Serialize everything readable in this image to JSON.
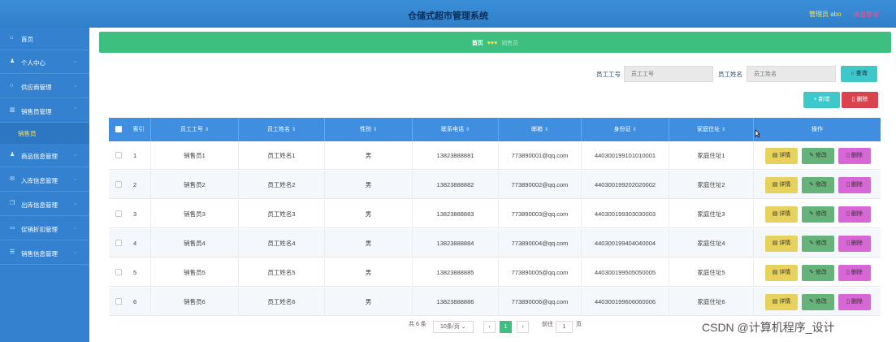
{
  "header": {
    "title": "仓储式超市管理系统",
    "admin": "管理员 abo",
    "logout": "退出登录"
  },
  "sidebar": {
    "items": [
      {
        "label": "首页",
        "icon": "home-icon"
      },
      {
        "label": "个人中心",
        "icon": "user-icon"
      },
      {
        "label": "供应商管理",
        "icon": "circle-icon"
      },
      {
        "label": "销售员管理",
        "icon": "chart-icon"
      },
      {
        "label": "商品信息管理",
        "icon": "user-icon"
      },
      {
        "label": "入库信息管理",
        "icon": "mail-icon"
      },
      {
        "label": "出库信息管理",
        "icon": "copy-icon"
      },
      {
        "label": "促销折扣管理",
        "icon": "doc-icon"
      },
      {
        "label": "销售信息管理",
        "icon": "list-icon"
      }
    ],
    "active_sub": "销售员"
  },
  "breadcrumb": {
    "home": "首页",
    "hearts": "♥♥♥",
    "current": "销售员"
  },
  "search": {
    "label_id": "员工工号",
    "placeholder_id": "员工工号",
    "label_name": "员工姓名",
    "placeholder_name": "员工姓名",
    "button": "查询"
  },
  "actions": {
    "add": "新增",
    "delete": "删除"
  },
  "table": {
    "headers": [
      "索引",
      "员工工号",
      "员工姓名",
      "性别",
      "联系电话",
      "邮箱",
      "身份证",
      "家庭住址",
      "操作"
    ],
    "rows": [
      {
        "idx": "1",
        "id": "销售员1",
        "name": "员工姓名1",
        "gender": "男",
        "phone": "13823888881",
        "email": "773890001@qq.com",
        "idcard": "440300199101010001",
        "addr": "家庭住址1"
      },
      {
        "idx": "2",
        "id": "销售员2",
        "name": "员工姓名2",
        "gender": "男",
        "phone": "13823888882",
        "email": "773890002@qq.com",
        "idcard": "440300199202020002",
        "addr": "家庭住址2"
      },
      {
        "idx": "3",
        "id": "销售员3",
        "name": "员工姓名3",
        "gender": "男",
        "phone": "13823888883",
        "email": "773890003@qq.com",
        "idcard": "440300199303030003",
        "addr": "家庭住址3"
      },
      {
        "idx": "4",
        "id": "销售员4",
        "name": "员工姓名4",
        "gender": "男",
        "phone": "13823888884",
        "email": "773890004@qq.com",
        "idcard": "440300199404040004",
        "addr": "家庭住址4"
      },
      {
        "idx": "5",
        "id": "销售员5",
        "name": "员工姓名5",
        "gender": "男",
        "phone": "13823888885",
        "email": "773890005@qq.com",
        "idcard": "440300199505050005",
        "addr": "家庭住址5"
      },
      {
        "idx": "6",
        "id": "销售员6",
        "name": "员工姓名6",
        "gender": "男",
        "phone": "13823888886",
        "email": "773890006@qq.com",
        "idcard": "440300199606060006",
        "addr": "家庭住址6"
      }
    ],
    "row_actions": {
      "detail": "详情",
      "edit": "修改",
      "delete": "删除"
    }
  },
  "pagination": {
    "total": "共 6 条",
    "page_size": "10条/页",
    "prev": "‹",
    "page": "1",
    "next": "›",
    "goto": "前往",
    "goto_value": "1",
    "page_unit": "页"
  },
  "watermark": "CSDN @计算机程序_设计"
}
